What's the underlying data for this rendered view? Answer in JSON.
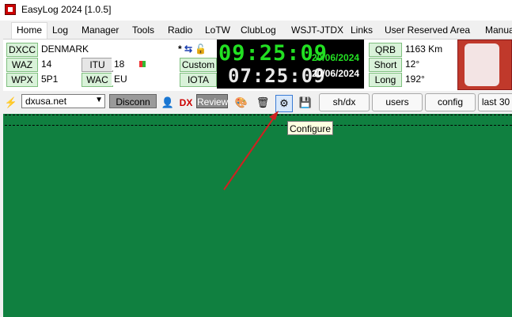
{
  "window": {
    "title": "EasyLog 2024 [1.0.5]"
  },
  "menu": [
    {
      "label": "Home"
    },
    {
      "label": "Log"
    },
    {
      "label": "Manager"
    },
    {
      "label": "Tools"
    },
    {
      "label": "Radio"
    },
    {
      "label": "LoTW"
    },
    {
      "label": "ClubLog"
    },
    {
      "label": "WSJT-JTDX"
    },
    {
      "label": "Links"
    },
    {
      "label": "User Reserved Area"
    },
    {
      "label": "Manua"
    }
  ],
  "info": {
    "dxcc_label": "DXCC",
    "dxcc_value": "DENMARK",
    "waz_label": "WAZ",
    "waz_value": "14",
    "itu_label": "ITU",
    "itu_value": "18",
    "wpx_label": "WPX",
    "wpx_value": "5P1",
    "wac_label": "WAC",
    "wac_value": "EU",
    "custom_label": "Custom",
    "iota_label": "IOTA",
    "qrb_label": "QRB",
    "qrb_value": "1163 Km",
    "short_label": "Short",
    "short_value": "12°",
    "long_label": "Long",
    "long_value": "192°"
  },
  "clock": {
    "local_time": "09:25:09",
    "local_date": "20/06/2024",
    "utc_time": "07:25:09",
    "utc_date": "20/06/2024"
  },
  "toolbar": {
    "cluster_server": "dxusa.net",
    "disconn_label": "Disconn",
    "review_label": "Review",
    "shdx_label": "sh/dx",
    "users_label": "users",
    "config_label": "config",
    "last30_label": "last 30"
  },
  "tooltip": {
    "text": "Configure"
  },
  "colors": {
    "spot_area": "#108040",
    "clock_green": "#22e022",
    "arrow": "#d02020"
  }
}
